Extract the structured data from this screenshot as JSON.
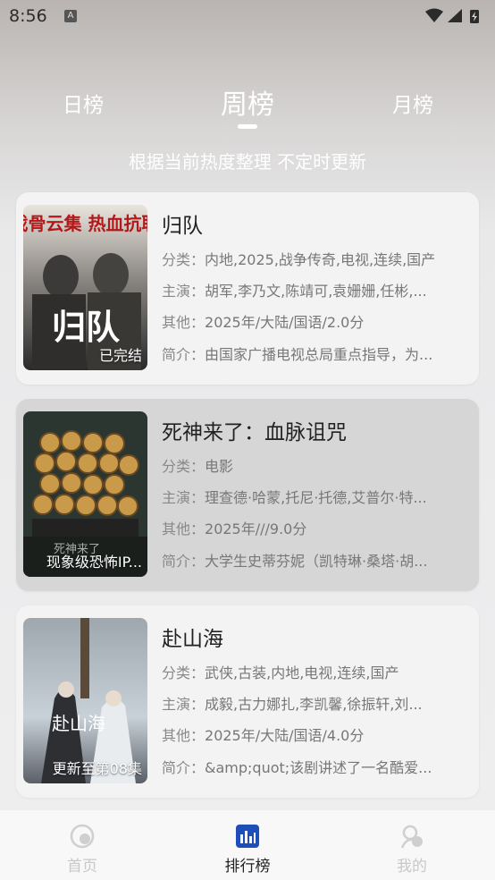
{
  "status_bar": {
    "time": "8:56",
    "notif_letter": "A"
  },
  "tabs": [
    {
      "label": "日榜",
      "active": false
    },
    {
      "label": "周榜",
      "active": true
    },
    {
      "label": "月榜",
      "active": false
    }
  ],
  "subtitle": "根据当前热度整理 不定时更新",
  "field_labels": {
    "category": "分类：",
    "cast": "主演：",
    "other": "其他：",
    "intro": "简介："
  },
  "items": [
    {
      "title": "归队",
      "poster_text": "戏骨云集 热血抗联",
      "poster_logo": "归队",
      "badge": "已完结",
      "category": "内地,2025,战争传奇,电视,连续,国产",
      "cast": "胡军,李乃文,陈靖可,袁姗姗,任彬,...",
      "other": "2025年/大陆/国语/2.0分",
      "intro": "由国家广播电视总局重点指导，为..."
    },
    {
      "title": "死神来了：血脉诅咒",
      "poster_text": "死神来了",
      "badge": "现象级恐怖IP...",
      "category": "电影",
      "cast": "理查德·哈蒙,托尼·托德,艾普尔·特...",
      "other": "2025年///9.0分",
      "intro": "大学生史蒂芬妮（凯特琳·桑塔·胡..."
    },
    {
      "title": "赴山海",
      "poster_text": "赴山海",
      "badge": "更新至第08集",
      "category": "武侠,古装,内地,电视,连续,国产",
      "cast": "成毅,古力娜扎,李凯馨,徐振轩,刘...",
      "other": "2025年/大陆/国语/4.0分",
      "intro": "&amp;quot;该剧讲述了一名酷爱..."
    }
  ],
  "bottom_nav": [
    {
      "label": "首页",
      "icon": "home-icon",
      "active": false
    },
    {
      "label": "排行榜",
      "icon": "ranking-icon",
      "active": true
    },
    {
      "label": "我的",
      "icon": "profile-icon",
      "active": false
    }
  ],
  "colors": {
    "accent": "#1e4fb8",
    "card_bg": "#f3f3f4",
    "card_alt_bg": "#d6d6d6"
  }
}
